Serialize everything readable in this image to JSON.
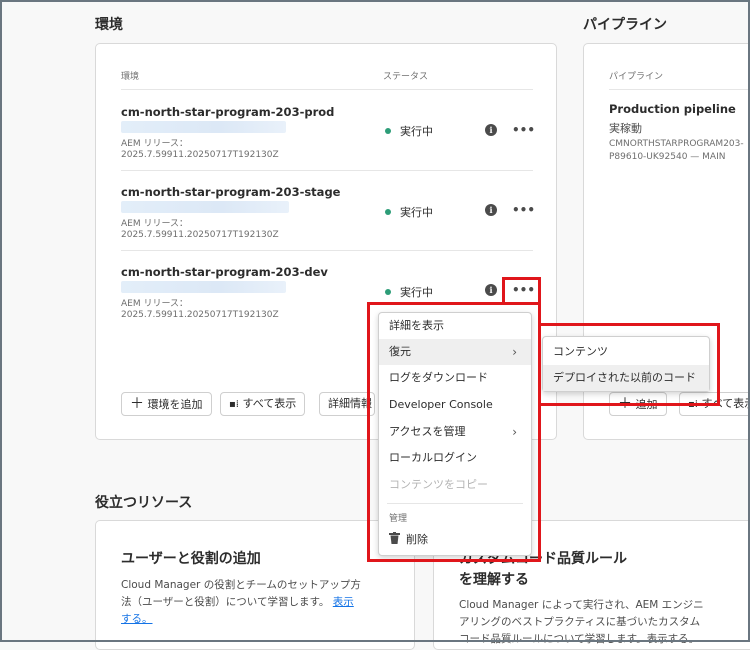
{
  "environments": {
    "title": "環境",
    "col_env": "環境",
    "col_status": "ステータス",
    "rows": [
      {
        "name": "cm-north-star-program-203-prod",
        "release_label": "AEM リリース：",
        "release_version": "2025.7.59911.20250717T192130Z",
        "status": "実行中"
      },
      {
        "name": "cm-north-star-program-203-stage",
        "release_label": "AEM リリース：",
        "release_version": "2025.7.59911.20250717T192130Z",
        "status": "実行中"
      },
      {
        "name": "cm-north-star-program-203-dev",
        "release_label": "AEM リリース：",
        "release_version": "2025.7.59911.20250717T192130Z",
        "status": "実行中"
      }
    ],
    "add_button": "環境を追加",
    "show_all_button": "すべて表示",
    "details_button": "詳細情報"
  },
  "pipelines": {
    "title": "パイプライン",
    "col_pipeline": "パイプライン",
    "name": "Production pipeline",
    "status": "実稼動",
    "repo_line1": "CMNORTHSTARPROGRAM203-",
    "repo_line2": "P89610-UK92540 — MAIN",
    "add_button": "追加",
    "show_all_button": "すべて表示"
  },
  "context_menu": {
    "items": [
      "詳細を表示",
      "復元",
      "ログをダウンロード",
      "Developer Console",
      "アクセスを管理",
      "ローカルログイン",
      "コンテンツをコピー"
    ],
    "section_label": "管理",
    "delete_label": "削除"
  },
  "submenu": {
    "items": [
      "コンテンツ",
      "デプロイされた以前のコード"
    ]
  },
  "resources": {
    "title": "役立つリソース",
    "card1_title": "ユーザーと役割の追加",
    "card1_text_l1": "Cloud Manager の役割とチームのセットアップ方",
    "card1_text_l2": "法（ユーザーと役割）について学習します。",
    "card1_link_a": "表示",
    "card1_link_b": "する。",
    "card2_title_l1": "カスタムコード品質ルール",
    "card2_title_l2": "を理解する",
    "card2_text_l1": "Cloud Manager によって実行され、AEM エンジニ",
    "card2_text_l2": "アリングのベストプラクティスに基づいたカスタム",
    "card2_text_l3": "コード品質ルールについて学習します。表示する。"
  },
  "icons": {
    "info": "info-icon",
    "more": "more-icon",
    "add": "plus-icon",
    "grid": "view-all-icon",
    "chevron": "chevron-right-icon",
    "trash": "trash-icon"
  },
  "colors": {
    "status_green": "#2d9d78",
    "highlight_red": "#e0161b",
    "link_blue": "#1473e6"
  }
}
